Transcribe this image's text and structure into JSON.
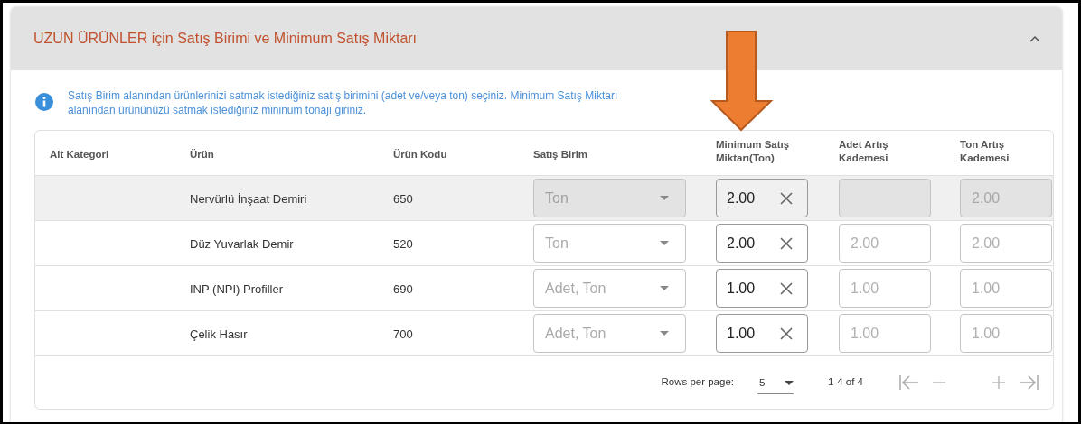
{
  "panel": {
    "title": "UZUN ÜRÜNLER için Satış Birimi ve Minimum Satış Miktarı",
    "expanded": true,
    "info": "Satış Birim alanından ürünlerinizi satmak istediğiniz satış birimini (adet ve/veya ton) seçiniz. Minimum Satış Miktarı alanından ürününüzü satmak istediğiniz mininum tonajı giriniz."
  },
  "table": {
    "columns": [
      "Alt Kategori",
      "Ürün",
      "Ürün Kodu",
      "Satış Birim",
      "Minimum Satış Miktarı(Ton)",
      "Adet Artış Kademesi",
      "Ton Artış Kademesi"
    ],
    "rows": [
      {
        "selected": true,
        "product": "Nervürlü İnşaat Demiri",
        "code": "650",
        "unit": {
          "value": "Ton",
          "disabled": true
        },
        "min_qty": "2.00",
        "adet_step": {
          "disabled": true
        },
        "ton_step": {
          "value": "2.00",
          "disabled": true
        }
      },
      {
        "selected": false,
        "product": "Düz Yuvarlak Demir",
        "code": "520",
        "unit": {
          "value": "Ton",
          "disabled": false
        },
        "min_qty": "2.00",
        "adet_step": {
          "value": "2.00",
          "disabled": false
        },
        "ton_step": {
          "value": "2.00",
          "disabled": false
        }
      },
      {
        "selected": false,
        "product": "INP (NPI) Profiller",
        "code": "690",
        "unit": {
          "value": "Adet, Ton",
          "disabled": false
        },
        "min_qty": "1.00",
        "adet_step": {
          "value": "1.00",
          "disabled": false
        },
        "ton_step": {
          "value": "1.00",
          "disabled": false
        }
      },
      {
        "selected": false,
        "product": "Çelik Hasır",
        "code": "700",
        "unit": {
          "value": "Adet, Ton",
          "disabled": false
        },
        "min_qty": "1.00",
        "adet_step": {
          "value": "1.00",
          "disabled": false
        },
        "ton_step": {
          "value": "1.00",
          "disabled": false
        }
      }
    ]
  },
  "pagination": {
    "rows_per_page_label": "Rows per page:",
    "rows_per_page": "5",
    "range": "1-4 of 4"
  }
}
